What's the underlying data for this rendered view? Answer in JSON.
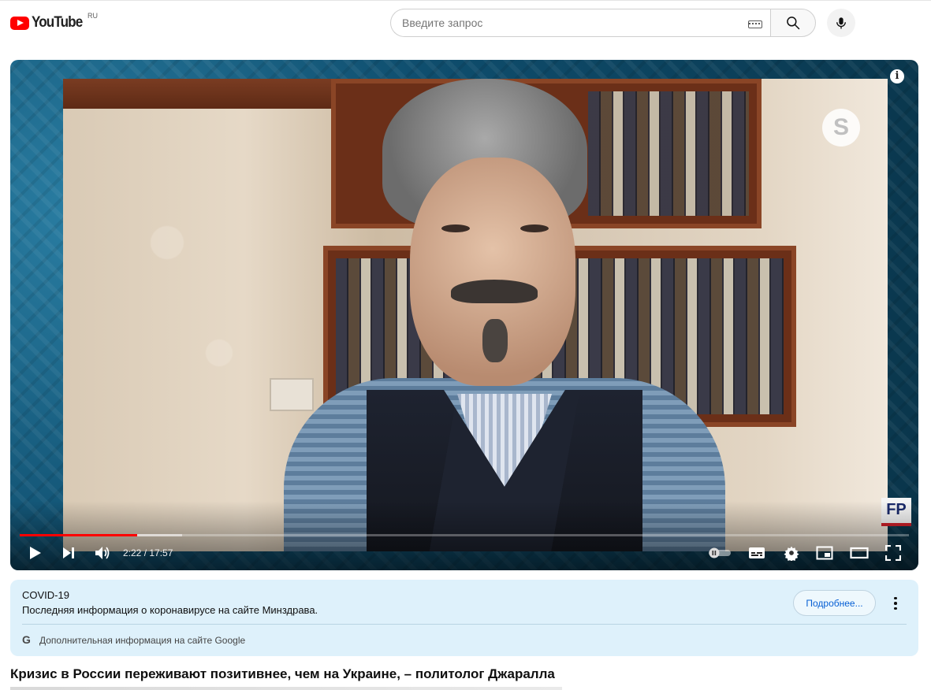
{
  "header": {
    "logo_text": "YouTube",
    "region": "RU",
    "search_placeholder": "Введите запрос"
  },
  "player": {
    "time_current": "2:22",
    "time_separator": "/",
    "time_total": "17:57",
    "time_display": "2:22 / 17:57",
    "progress_fraction": 0.132,
    "buffer_fraction": 0.183,
    "watermark_text": "FP"
  },
  "covid_panel": {
    "title": "COVID-19",
    "description": "Последняя информация о коронавирусе на сайте Минздрава.",
    "more_button": "Подробнее...",
    "source_text": "Дополнительная информация на сайте Google"
  },
  "video": {
    "title": "Кризис в России переживают позитивнее, чем на Украине, – политолог Джаралла"
  },
  "colors": {
    "accent_red": "#ff0000",
    "panel_bg": "#def1fb",
    "link_blue": "#065fd4"
  }
}
